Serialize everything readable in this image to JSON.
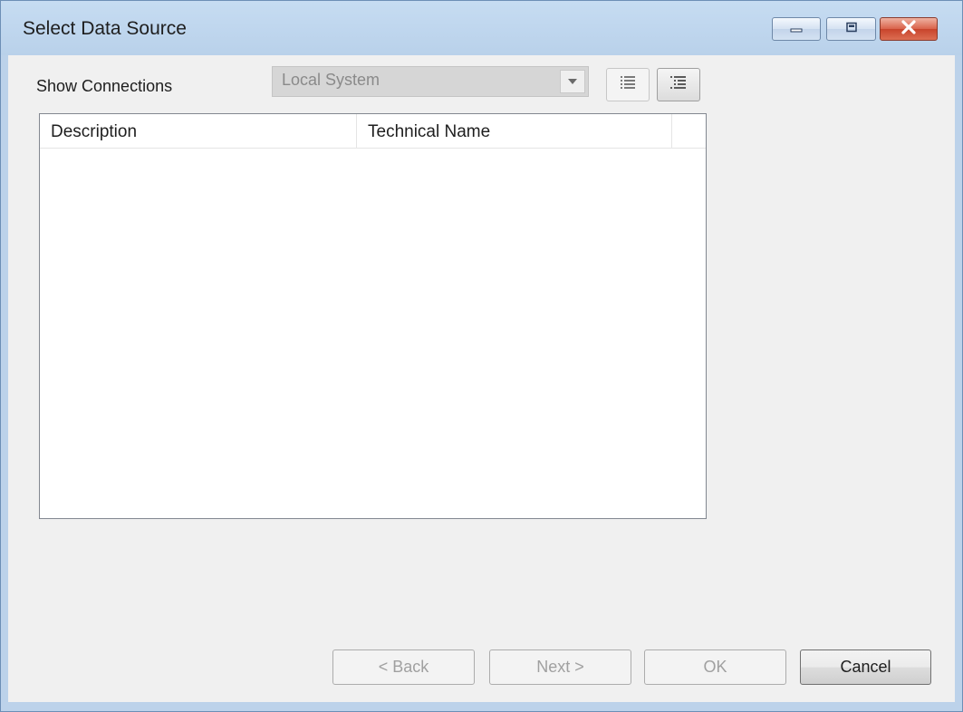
{
  "window": {
    "title": "Select Data Source",
    "controls": {
      "minimize": "minimize-icon",
      "maximize": "maximize-icon",
      "close": "close-icon"
    }
  },
  "connections": {
    "label": "Show Connections",
    "selected": "Local System",
    "enabled": false
  },
  "view_buttons": {
    "list_view": "list-view-icon",
    "tree_view": "tree-view-icon",
    "active": "tree_view"
  },
  "table": {
    "columns": [
      "Description",
      "Technical Name"
    ],
    "rows": []
  },
  "buttons": {
    "back": "< Back",
    "next": "Next >",
    "ok": "OK",
    "cancel": "Cancel"
  },
  "colors": {
    "titlebar": "#bcd2ea",
    "close_button": "#d9624a",
    "background": "#f0f0f0"
  }
}
